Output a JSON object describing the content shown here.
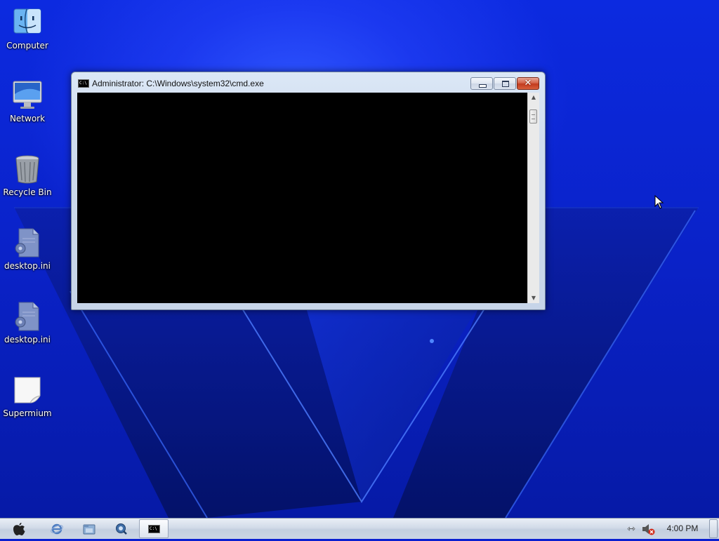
{
  "desktop": {
    "icons": [
      {
        "label": "Computer",
        "icon": "finder-face-icon"
      },
      {
        "label": "Network",
        "icon": "imac-monitor-icon"
      },
      {
        "label": "Recycle Bin",
        "icon": "trash-can-icon"
      },
      {
        "label": "desktop.ini",
        "icon": "settings-file-icon"
      },
      {
        "label": "desktop.ini",
        "icon": "settings-file-icon"
      },
      {
        "label": "Supermium",
        "icon": "blank-document-icon"
      }
    ]
  },
  "cmd_window": {
    "title": "Administrator: C:\\Windows\\system32\\cmd.exe",
    "icon_text": "C:\\",
    "close_glyph": "✕"
  },
  "taskbar": {
    "clock": "4:00 PM",
    "cmd_icon_text": "C:\\",
    "items": [
      "apple-start-icon",
      "internet-explorer-icon",
      "file-explorer-icon",
      "media-player-icon",
      "cmd-taskbar-icon"
    ],
    "tray": [
      "network-icon",
      "volume-muted-icon"
    ]
  },
  "colors": {
    "wallpaper_blue": "#0a22c8",
    "console_black": "#000000",
    "close_red": "#c23a1e"
  }
}
